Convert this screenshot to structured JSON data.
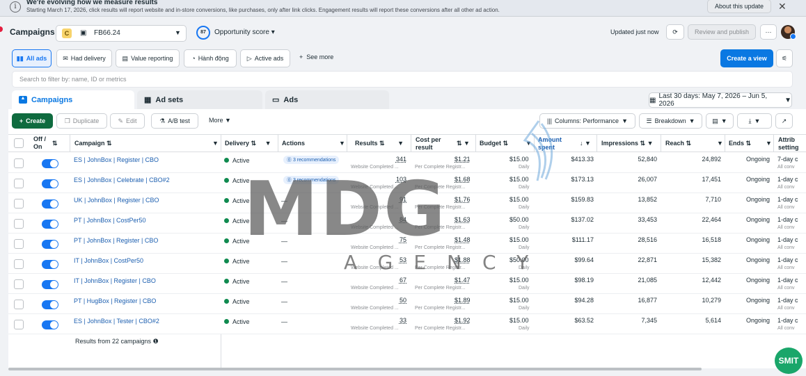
{
  "banner": {
    "title": "We're evolving how we measure results",
    "text": "Starting March 17, 2026, click results will report website and in-store conversions, like purchases, only after link clicks. Engagement results will report these conversions after all other ad action.",
    "about_label": "About this update"
  },
  "header": {
    "title": "Campaigns",
    "account_badge": "C",
    "account_name": "FB66.24",
    "opp_score": "87",
    "opp_label": "Opportunity score",
    "updated": "Updated just now",
    "review_label": "Review and publish"
  },
  "filters": {
    "chips": [
      "All ads",
      "Had delivery",
      "Value reporting",
      "Hành động",
      "Active ads",
      "See more"
    ],
    "create_view": "Create a view"
  },
  "search": {
    "placeholder": "Search to filter by: name, ID or metrics"
  },
  "tabs": {
    "campaigns": "Campaigns",
    "adsets": "Ad sets",
    "ads": "Ads"
  },
  "date_range": "Last 30 days: May 7, 2026 – Jun 5, 2026",
  "toolbar": {
    "create": "Create",
    "duplicate": "Duplicate",
    "edit": "Edit",
    "ab_test": "A/B test",
    "more": "More",
    "columns": "Columns: Performance",
    "breakdown": "Breakdown"
  },
  "columns": {
    "offon": "Off / On",
    "campaign": "Campaign",
    "delivery": "Delivery",
    "actions": "Actions",
    "results": "Results",
    "cost": "Cost per result",
    "budget": "Budget",
    "amount": "Amount spent",
    "impressions": "Impressions",
    "reach": "Reach",
    "ends": "Ends",
    "attribution": "Attrib setting"
  },
  "rows": [
    {
      "name": "ES | JohnBox | Register | CBO",
      "delivery": "Active",
      "actions": "3 recommendations",
      "results": "341",
      "results_sub": "Website Completed ...",
      "cost": "$1.21",
      "cost_sub": "Per Complete Registr...",
      "budget": "$15.00",
      "budget_sub": "Daily",
      "spent": "$413.33",
      "impressions": "52,840",
      "reach": "24,892",
      "ends": "Ongoing",
      "attr": "7-day c",
      "attr_sub": "All conv"
    },
    {
      "name": "ES | JohnBox | Celebrate | CBO#2",
      "delivery": "Active",
      "actions": "3 recommendations",
      "results": "103",
      "results_sub": "Website Completed ...",
      "cost": "$1.68",
      "cost_sub": "Per Complete Registr...",
      "budget": "$15.00",
      "budget_sub": "Daily",
      "spent": "$173.13",
      "impressions": "26,007",
      "reach": "17,451",
      "ends": "Ongoing",
      "attr": "1-day c",
      "attr_sub": "All conv"
    },
    {
      "name": "UK | JohnBox | Register | CBO",
      "delivery": "Active",
      "actions": "—",
      "results": "91",
      "results_sub": "Website Completed ...",
      "cost": "$1.76",
      "cost_sub": "Per Complete Registr...",
      "budget": "$15.00",
      "budget_sub": "Daily",
      "spent": "$159.83",
      "impressions": "13,852",
      "reach": "7,710",
      "ends": "Ongoing",
      "attr": "1-day c",
      "attr_sub": "All conv"
    },
    {
      "name": "PT | JohnBox | CostPer50",
      "delivery": "Active",
      "actions": "—",
      "results": "84",
      "results_sub": "Website Completed ...",
      "cost": "$1.63",
      "cost_sub": "Per Complete Registr...",
      "budget": "$50.00",
      "budget_sub": "Daily",
      "spent": "$137.02",
      "impressions": "33,453",
      "reach": "22,464",
      "ends": "Ongoing",
      "attr": "1-day c",
      "attr_sub": "All conv"
    },
    {
      "name": "PT | JohnBox | Register | CBO",
      "delivery": "Active",
      "actions": "—",
      "results": "75",
      "results_sub": "Website Completed ...",
      "cost": "$1.48",
      "cost_sub": "Per Complete Registr...",
      "budget": "$15.00",
      "budget_sub": "Daily",
      "spent": "$111.17",
      "impressions": "28,516",
      "reach": "16,518",
      "ends": "Ongoing",
      "attr": "1-day c",
      "attr_sub": "All conv"
    },
    {
      "name": "IT | JohnBox | CostPer50",
      "delivery": "Active",
      "actions": "—",
      "results": "53",
      "results_sub": "Website Completed ...",
      "cost": "$1.88",
      "cost_sub": "Per Complete Registr...",
      "budget": "$50.00",
      "budget_sub": "Daily",
      "spent": "$99.64",
      "impressions": "22,871",
      "reach": "15,382",
      "ends": "Ongoing",
      "attr": "1-day c",
      "attr_sub": "All conv"
    },
    {
      "name": "IT | JohnBox | Register | CBO",
      "delivery": "Active",
      "actions": "—",
      "results": "67",
      "results_sub": "Website Completed ...",
      "cost": "$1.47",
      "cost_sub": "Per Complete Registr...",
      "budget": "$15.00",
      "budget_sub": "Daily",
      "spent": "$98.19",
      "impressions": "21,085",
      "reach": "12,442",
      "ends": "Ongoing",
      "attr": "1-day c",
      "attr_sub": "All conv"
    },
    {
      "name": "PT | HugBox | Register | CBO",
      "delivery": "Active",
      "actions": "—",
      "results": "50",
      "results_sub": "Website Completed ...",
      "cost": "$1.89",
      "cost_sub": "Per Complete Registr...",
      "budget": "$15.00",
      "budget_sub": "Daily",
      "spent": "$94.28",
      "impressions": "16,877",
      "reach": "10,279",
      "ends": "Ongoing",
      "attr": "1-day c",
      "attr_sub": "All conv"
    },
    {
      "name": "ES | JohnBox | Tester | CBO#2",
      "delivery": "Active",
      "actions": "—",
      "results": "33",
      "results_sub": "Website Completed ...",
      "cost": "$1.92",
      "cost_sub": "Per Complete Registr...",
      "budget": "$15.00",
      "budget_sub": "Daily",
      "spent": "$63.52",
      "impressions": "7,345",
      "reach": "5,614",
      "ends": "Ongoing",
      "attr": "1-day c",
      "attr_sub": "All conv"
    }
  ],
  "footer": {
    "results_from": "Results from 22 campaigns"
  },
  "watermark": {
    "main": "MDG",
    "sub": "AGENCY"
  },
  "smit_badge": "SMIT"
}
